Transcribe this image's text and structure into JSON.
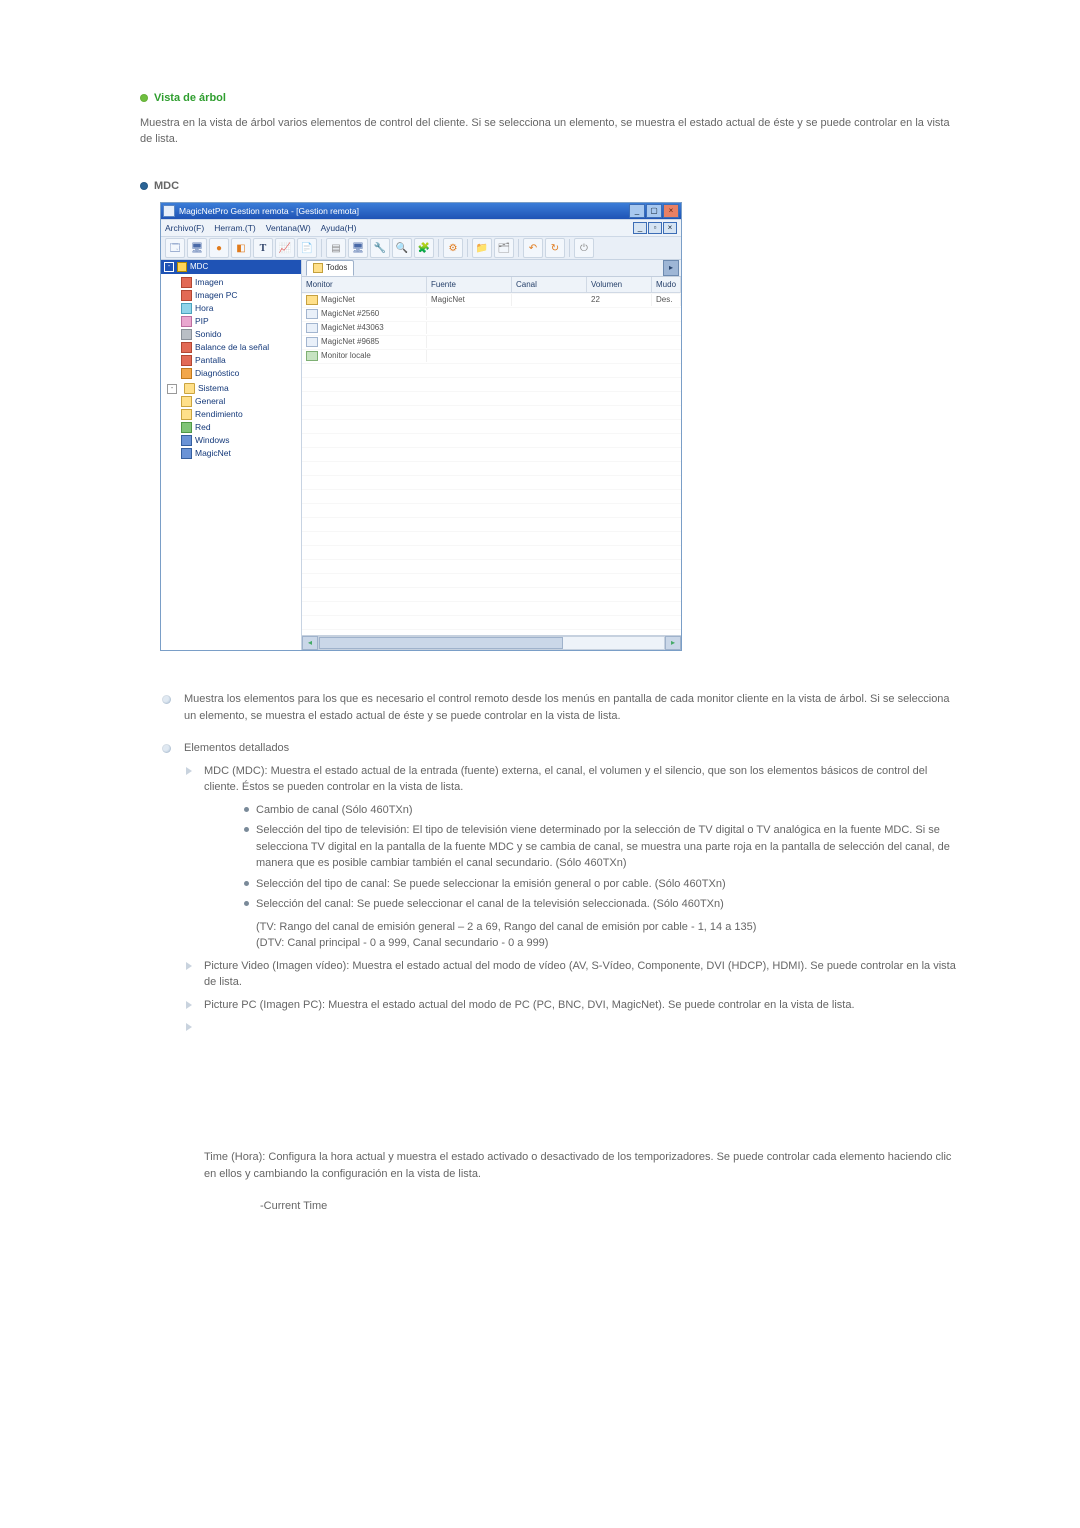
{
  "section1": {
    "title": "Vista de árbol",
    "para": "Muestra en la vista de árbol varios elementos de control del cliente. Si se selecciona un elemento, se muestra el estado actual de éste y se puede controlar en la vista de lista."
  },
  "section2": {
    "title": "MDC"
  },
  "window": {
    "title": "MagicNetPro Gestion remota - [Gestion remota]",
    "menus": {
      "file": "Archivo(F)",
      "tools": "Herram.(T)",
      "window": "Ventana(W)",
      "help": "Ayuda(H)"
    },
    "tree_header": "MDC",
    "tree": {
      "imagen": "Imagen",
      "imagen_pc": "Imagen PC",
      "hora": "Hora",
      "pip": "PIP",
      "sonido": "Sonido",
      "balance": "Balance de la señal",
      "pantalla": "Pantalla",
      "diagnostico": "Diagnóstico",
      "sistema": "Sistema",
      "general": "General",
      "rendimiento": "Rendimiento",
      "red": "Red",
      "windows": "Windows",
      "magicnet": "MagicNet"
    },
    "tab": "Todos",
    "columns": {
      "monitor": "Monitor",
      "fuente": "Fuente",
      "canal": "Canal",
      "volumen": "Volumen",
      "mudo": "Mudo"
    },
    "rows": [
      {
        "monitor": "MagicNet",
        "fuente": "MagicNet",
        "canal": "",
        "volumen": "22",
        "mudo": "Des."
      },
      {
        "monitor": "MagicNet #2560",
        "fuente": "",
        "canal": "",
        "volumen": "",
        "mudo": ""
      },
      {
        "monitor": "MagicNet #43063",
        "fuente": "",
        "canal": "",
        "volumen": "",
        "mudo": ""
      },
      {
        "monitor": "MagicNet #9685",
        "fuente": "",
        "canal": "",
        "volumen": "",
        "mudo": ""
      },
      {
        "monitor": "Monitor locale",
        "fuente": "",
        "canal": "",
        "volumen": "",
        "mudo": ""
      }
    ]
  },
  "below": {
    "p1": "Muestra los elementos para los que es necesario el control remoto desde los menús en pantalla de cada monitor cliente en la vista de árbol. Si se selecciona un elemento, se muestra el estado actual de éste y se puede controlar en la vista de lista.",
    "detalle_head": "Elementos detallados",
    "mdc": "MDC (MDC): Muestra el estado actual de la entrada (fuente) externa, el canal, el volumen y el silencio, que son los elementos básicos de control del cliente. Éstos se pueden controlar en la vista de lista.",
    "b1": "Cambio de canal (Sólo 460TXn)",
    "b2": "Selección del tipo de televisión: El tipo de televisión viene determinado por la selección de TV digital o TV analógica en la fuente MDC. Si se selecciona TV digital en la pantalla de la fuente MDC y se cambia de canal, se muestra una parte roja en la pantalla de selección del canal, de manera que es posible cambiar también el canal secundario. (Sólo 460TXn)",
    "b3": "Selección del tipo de canal: Se puede seleccionar la emisión general o por cable. (Sólo 460TXn)",
    "b4": "Selección del canal: Se puede seleccionar el canal de la televisión seleccionada. (Sólo 460TXn)",
    "b4a": "(TV: Rango del canal de emisión general – 2 a 69, Rango del canal de emisión por cable - 1, 14 a 135)",
    "b4b": "(DTV: Canal principal - 0 a 999, Canal secundario - 0 a 999)",
    "pv": "Picture Video (Imagen vídeo): Muestra el estado actual del modo de vídeo (AV, S-Vídeo, Componente, DVI (HDCP), HDMI). Se puede controlar en la vista de lista.",
    "ppc": "Picture PC (Imagen PC): Muestra el estado actual del modo de PC (PC, BNC, DVI, MagicNet). Se puede controlar en la vista de lista.",
    "time": "Time (Hora): Configura la hora actual y muestra el estado activado o desactivado de los temporizadores. Se puede controlar cada elemento haciendo clic en ellos y cambiando la configuración en la vista de lista.",
    "ct": "-Current Time"
  }
}
